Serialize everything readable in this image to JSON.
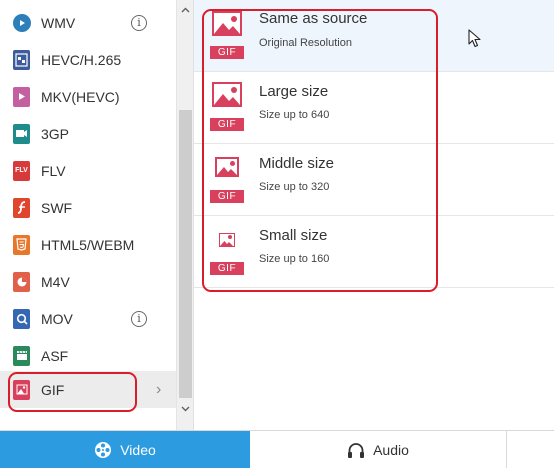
{
  "formats": [
    {
      "label": "WMV",
      "icon": "wmv-icon",
      "info": "i"
    },
    {
      "label": "HEVC/H.265",
      "icon": "hevc-icon"
    },
    {
      "label": "MKV(HEVC)",
      "icon": "mkv-icon"
    },
    {
      "label": "3GP",
      "icon": "3gp-icon"
    },
    {
      "label": "FLV",
      "icon": "flv-icon",
      "glyph": "FLV"
    },
    {
      "label": "SWF",
      "icon": "swf-icon"
    },
    {
      "label": "HTML5/WEBM",
      "icon": "html5-icon"
    },
    {
      "label": "M4V",
      "icon": "m4v-icon"
    },
    {
      "label": "MOV",
      "icon": "mov-icon",
      "info": "i"
    },
    {
      "label": "ASF",
      "icon": "asf-icon"
    },
    {
      "label": "GIF",
      "icon": "gif-icon",
      "selected": true,
      "chevron": "›"
    }
  ],
  "options": [
    {
      "title": "Same as source",
      "subtitle": "Original Resolution",
      "badge": "GIF"
    },
    {
      "title": "Large size",
      "subtitle": "Size up to 640",
      "badge": "GIF"
    },
    {
      "title": "Middle size",
      "subtitle": "Size up to 320",
      "badge": "GIF"
    },
    {
      "title": "Small size",
      "subtitle": "Size up to 160",
      "badge": "GIF"
    }
  ],
  "tabs": {
    "video": {
      "label": "Video",
      "icon": "film-reel-icon",
      "active": true
    },
    "audio": {
      "label": "Audio",
      "icon": "headphones-icon",
      "active": false
    }
  },
  "colors": {
    "accent": "#2c9be0",
    "gif": "#d8405e",
    "highlight": "#d81e2a"
  }
}
